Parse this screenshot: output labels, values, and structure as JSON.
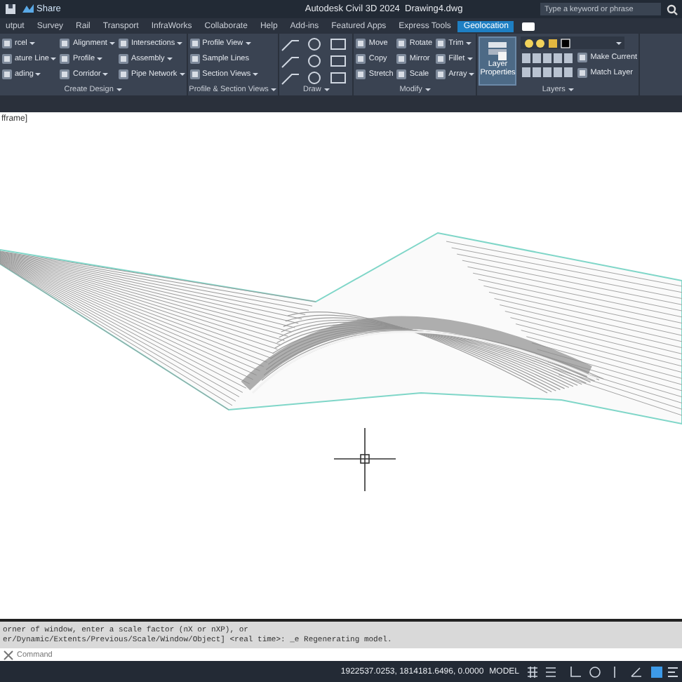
{
  "title_bar": {
    "share": "Share",
    "title": "Autodesk Civil 3D 2024",
    "file": "Drawing4.dwg",
    "search": {
      "placeholder": "Type a keyword or phrase"
    }
  },
  "tabs": [
    {
      "label": "utput",
      "selected": false
    },
    {
      "label": "Survey",
      "selected": false
    },
    {
      "label": "Rail",
      "selected": false
    },
    {
      "label": "Transport",
      "selected": false
    },
    {
      "label": "InfraWorks",
      "selected": false
    },
    {
      "label": "Collaborate",
      "selected": false
    },
    {
      "label": "Help",
      "selected": false
    },
    {
      "label": "Add-ins",
      "selected": false
    },
    {
      "label": "Featured Apps",
      "selected": false
    },
    {
      "label": "Express Tools",
      "selected": false
    },
    {
      "label": "Geolocation",
      "selected": true
    }
  ],
  "panels": [
    {
      "kind": "grid",
      "label": "Create Design",
      "columns": [
        [
          {
            "label": "rcel",
            "dropdown": true
          },
          {
            "label": "ature Line",
            "dropdown": true
          },
          {
            "label": "ading",
            "dropdown": true
          }
        ],
        [
          {
            "label": "Alignment",
            "dropdown": true
          },
          {
            "label": "Profile",
            "dropdown": true
          },
          {
            "label": "Corridor",
            "dropdown": true
          }
        ],
        [
          {
            "label": "Intersections",
            "dropdown": true
          },
          {
            "label": "Assembly",
            "dropdown": true
          },
          {
            "label": "Pipe Network",
            "dropdown": true
          }
        ]
      ]
    },
    {
      "kind": "grid",
      "label": "Profile & Section Views",
      "columns": [
        [
          {
            "label": "Profile View",
            "dropdown": true
          },
          {
            "label": "Sample Lines",
            "dropdown": false
          },
          {
            "label": "Section Views",
            "dropdown": true
          }
        ]
      ]
    },
    {
      "kind": "draw",
      "label": "Draw"
    },
    {
      "kind": "grid",
      "label": "Modify",
      "columns": [
        [
          {
            "label": "Move",
            "dropdown": false
          },
          {
            "label": "Copy",
            "dropdown": false
          },
          {
            "label": "Stretch",
            "dropdown": false
          }
        ],
        [
          {
            "label": "Rotate",
            "dropdown": false
          },
          {
            "label": "Mirror",
            "dropdown": false
          },
          {
            "label": "Scale",
            "dropdown": false
          }
        ],
        [
          {
            "label": "Trim",
            "dropdown": true
          },
          {
            "label": "Fillet",
            "dropdown": true
          },
          {
            "label": "Array",
            "dropdown": true
          }
        ]
      ]
    },
    {
      "kind": "layers",
      "label": "Layers",
      "big": "Layer Properties",
      "columns": [
        [
          {
            "label": "Make Current",
            "dropdown": false
          },
          {
            "label": "Match Layer",
            "dropdown": false
          }
        ]
      ]
    }
  ],
  "viewport": {
    "label": "fframe]"
  },
  "command": {
    "history": [
      "orner of window, enter a scale factor (nX or nXP), or",
      "er/Dynamic/Extents/Previous/Scale/Window/Object] <real time>: _e Regenerating model."
    ],
    "placeholder": "Command"
  },
  "status_bar": {
    "coordinates": "1922537.0253, 1814181.6496, 0.0000",
    "space": "MODEL"
  }
}
